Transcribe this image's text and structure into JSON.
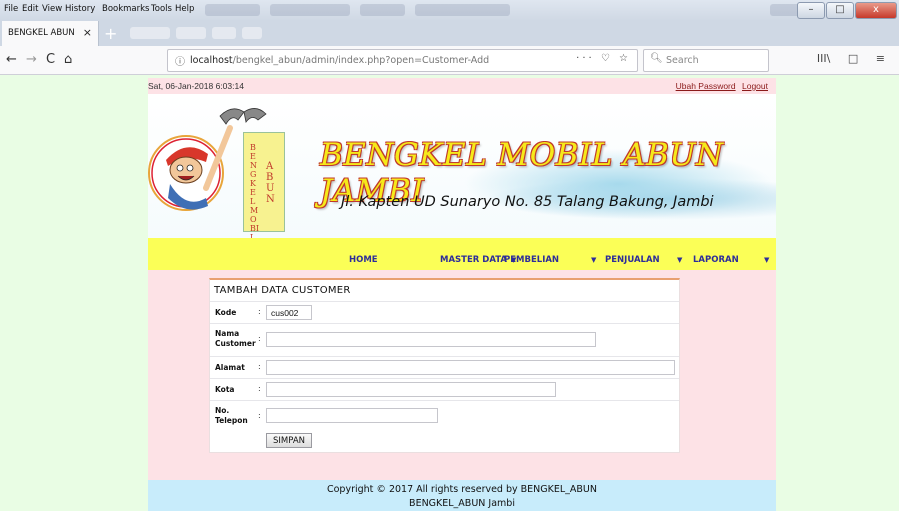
{
  "browser": {
    "menu": [
      "File",
      "Edit",
      "View",
      "History",
      "Bookmarks",
      "Tools",
      "Help"
    ],
    "tab_title": "BENGKEL ABUN",
    "tab_close": "×",
    "new_tab": "+",
    "back": "←",
    "forward": "→",
    "reload": "C",
    "home": "⌂",
    "url_host": "localhost",
    "url_path": "/bengkel_abun/admin/index.php?open=Customer-Add",
    "url_actions": "··· ♡ ☆",
    "search_placeholder": "Search",
    "toolbar_icons": [
      "III\\",
      "□",
      "≡"
    ],
    "window_buttons": [
      "–",
      "□",
      "x"
    ]
  },
  "header": {
    "datetime": "Sat, 06-Jan-2018 6:03:14",
    "link_change_password": "Ubah Password",
    "link_logout": "Logout"
  },
  "banner": {
    "title": "BENGKEL MOBIL ABUN JAMBI",
    "address": "Jl. Kapten UD Sunaryo No. 85 Talang Bakung, Jambi",
    "sign_text_1": "BENGKEL MOBIL",
    "sign_text_2": "ABUN"
  },
  "nav": {
    "items": [
      {
        "label": "HOME",
        "dropdown": false
      },
      {
        "label": "MASTER DATA",
        "dropdown": true
      },
      {
        "label": "PEMBELIAN",
        "dropdown": true
      },
      {
        "label": "PENJUALAN",
        "dropdown": true
      },
      {
        "label": "LAPORAN",
        "dropdown": true
      }
    ]
  },
  "form": {
    "title": "TAMBAH DATA CUSTOMER",
    "fields": [
      {
        "label": "Kode",
        "value": "cus002"
      },
      {
        "label": "Nama Customer",
        "value": ""
      },
      {
        "label": "Alamat",
        "value": ""
      },
      {
        "label": "Kota",
        "value": ""
      },
      {
        "label": "No. Telepon",
        "value": ""
      }
    ],
    "colon": ":",
    "submit_label": "SIMPAN"
  },
  "footer": {
    "line1": "Copyright © 2017 All rights reserved by BENGKEL_ABUN",
    "line2": "BENGKEL_ABUN Jambi"
  },
  "colors": {
    "page_bg": "#e9fde4",
    "content_bg": "#fde2e6",
    "menu_bg": "#fbff57",
    "footer_bg": "#c8ecfb",
    "title_yellow": "#f6ea1a",
    "title_outline": "#c0392b"
  }
}
